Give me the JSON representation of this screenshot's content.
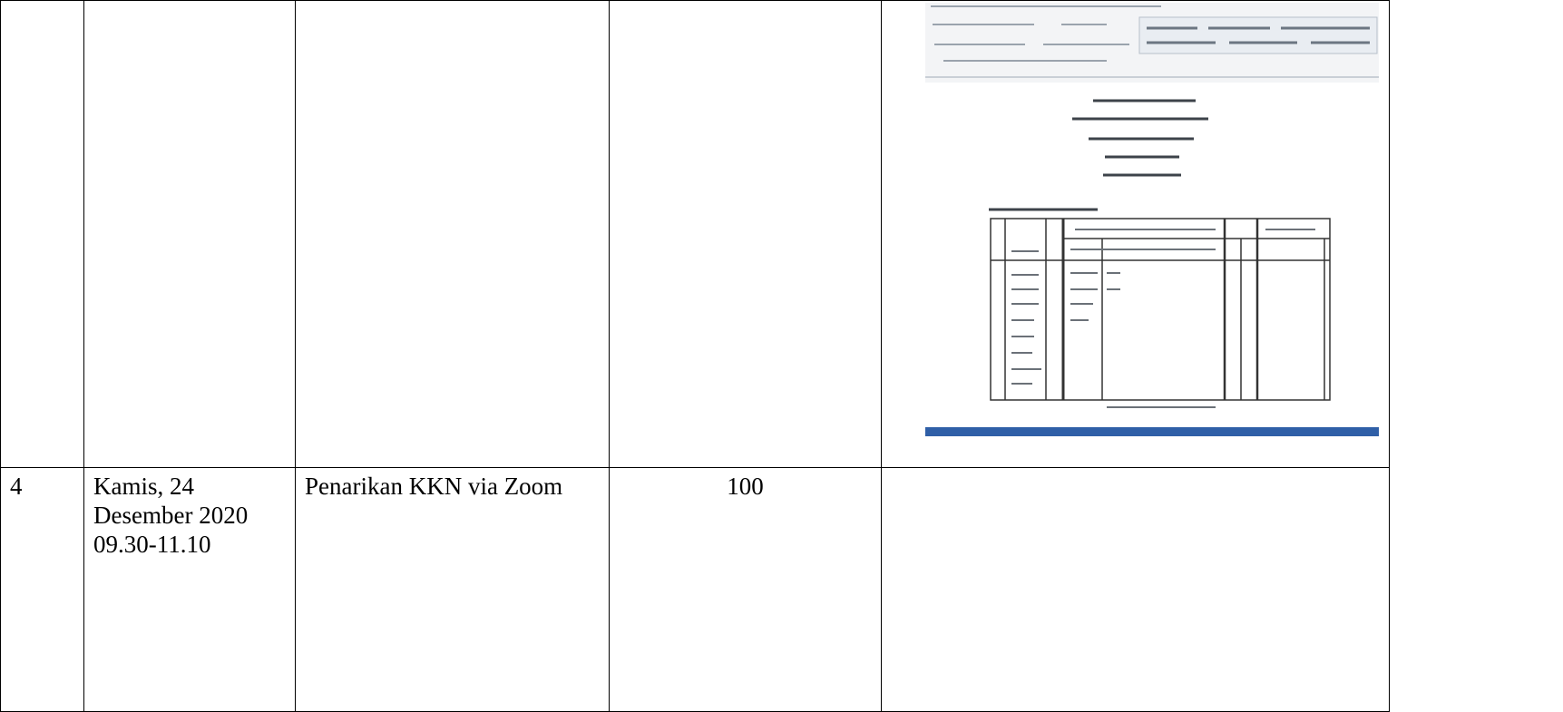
{
  "table": {
    "rows": [
      {
        "no": "",
        "date": "",
        "activity": "",
        "score": "",
        "evidence": "screenshot of document in word processor (illegible)"
      },
      {
        "no": "4",
        "date": "Kamis, 24\nDesember 2020\n09.30-11.10",
        "activity": "Penarikan KKN via Zoom",
        "score": "100",
        "evidence": ""
      }
    ]
  }
}
